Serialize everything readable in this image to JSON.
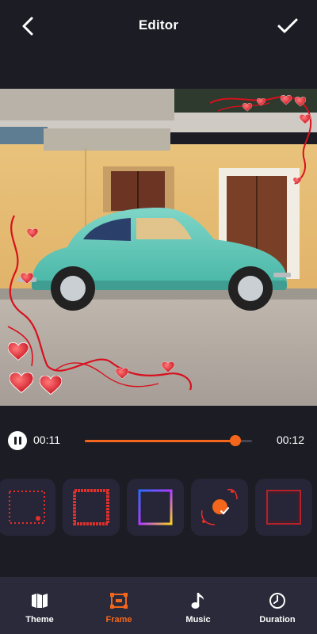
{
  "header": {
    "title": "Editor",
    "back_icon": "chevron-left-icon",
    "confirm_icon": "checkmark-icon"
  },
  "player": {
    "current_time": "00:11",
    "total_time": "00:12",
    "progress": 0.9,
    "state_icon": "pause-icon"
  },
  "frames": {
    "items": [
      {
        "name": "frame-dotted-red",
        "selected": false
      },
      {
        "name": "frame-red-flowers",
        "selected": false
      },
      {
        "name": "frame-rainbow",
        "selected": false
      },
      {
        "name": "frame-hearts-corner",
        "selected": true
      },
      {
        "name": "frame-dark-red",
        "selected": false
      }
    ]
  },
  "bottom_nav": {
    "items": [
      {
        "label": "Theme",
        "icon": "theme-icon",
        "active": false
      },
      {
        "label": "Frame",
        "icon": "frame-icon",
        "active": true
      },
      {
        "label": "Music",
        "icon": "music-note-icon",
        "active": false
      },
      {
        "label": "Duration",
        "icon": "clock-icon",
        "active": false
      }
    ]
  },
  "colors": {
    "background": "#1c1c24",
    "accent": "#f4661b",
    "nav_background": "#2a2a3a",
    "card_background": "#262638"
  }
}
